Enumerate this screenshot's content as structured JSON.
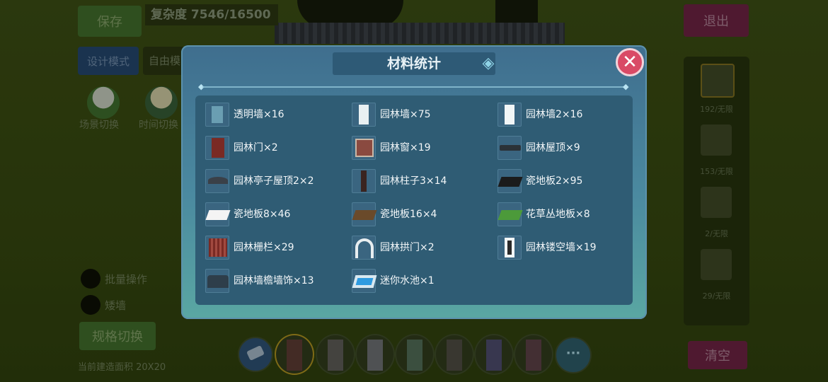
{
  "hud": {
    "save_label": "保存",
    "complexity_text": "复杂度 7546/16500",
    "design_mode_label": "设计模式",
    "free_mode_label": "自由模",
    "scene_switch_label": "场景切换",
    "time_switch_label": "时间切换",
    "batch_label": "批量操作",
    "low_wall_label": "矮墙",
    "spec_switch_label": "规格切换",
    "build_area_label": "当前建造面积 20X20",
    "exit_label": "退出",
    "clear_label": "清空",
    "more_label": "···"
  },
  "right_panel": {
    "counts": [
      "192/无限",
      "153/无限",
      "2/无限",
      "29/无限"
    ]
  },
  "modal": {
    "title": "材料统计",
    "close_glyph": "✕",
    "items": [
      {
        "label": "透明墙×16",
        "icon": "transparent-wall-icon"
      },
      {
        "label": "园林墙×75",
        "icon": "garden-wall-icon"
      },
      {
        "label": "园林墙2×16",
        "icon": "garden-wall-2-icon"
      },
      {
        "label": "园林门×2",
        "icon": "garden-door-icon"
      },
      {
        "label": "园林窗×19",
        "icon": "garden-window-icon"
      },
      {
        "label": "园林屋顶×9",
        "icon": "garden-roof-icon"
      },
      {
        "label": "园林亭子屋顶2×2",
        "icon": "pavilion-roof-icon"
      },
      {
        "label": "园林柱子3×14",
        "icon": "garden-pillar-icon"
      },
      {
        "label": "瓷地板2×95",
        "icon": "tile-floor-2-icon"
      },
      {
        "label": "瓷地板8×46",
        "icon": "tile-floor-8-icon"
      },
      {
        "label": "瓷地板16×4",
        "icon": "tile-floor-16-icon"
      },
      {
        "label": "花草丛地板×8",
        "icon": "flower-grass-floor-icon"
      },
      {
        "label": "园林栅栏×29",
        "icon": "garden-fence-icon"
      },
      {
        "label": "园林拱门×2",
        "icon": "garden-arch-icon"
      },
      {
        "label": "园林镂空墙×19",
        "icon": "garden-lattice-wall-icon"
      },
      {
        "label": "园林墙檐墙饰×13",
        "icon": "wall-eave-decor-icon"
      },
      {
        "label": "迷你水池×1",
        "icon": "mini-pool-icon"
      }
    ]
  },
  "colors": {
    "modal_top": "#3f6e8e",
    "modal_bottom": "#5aa7a2",
    "list_panel": "#2f5c74",
    "close_button": "#d94a66"
  }
}
